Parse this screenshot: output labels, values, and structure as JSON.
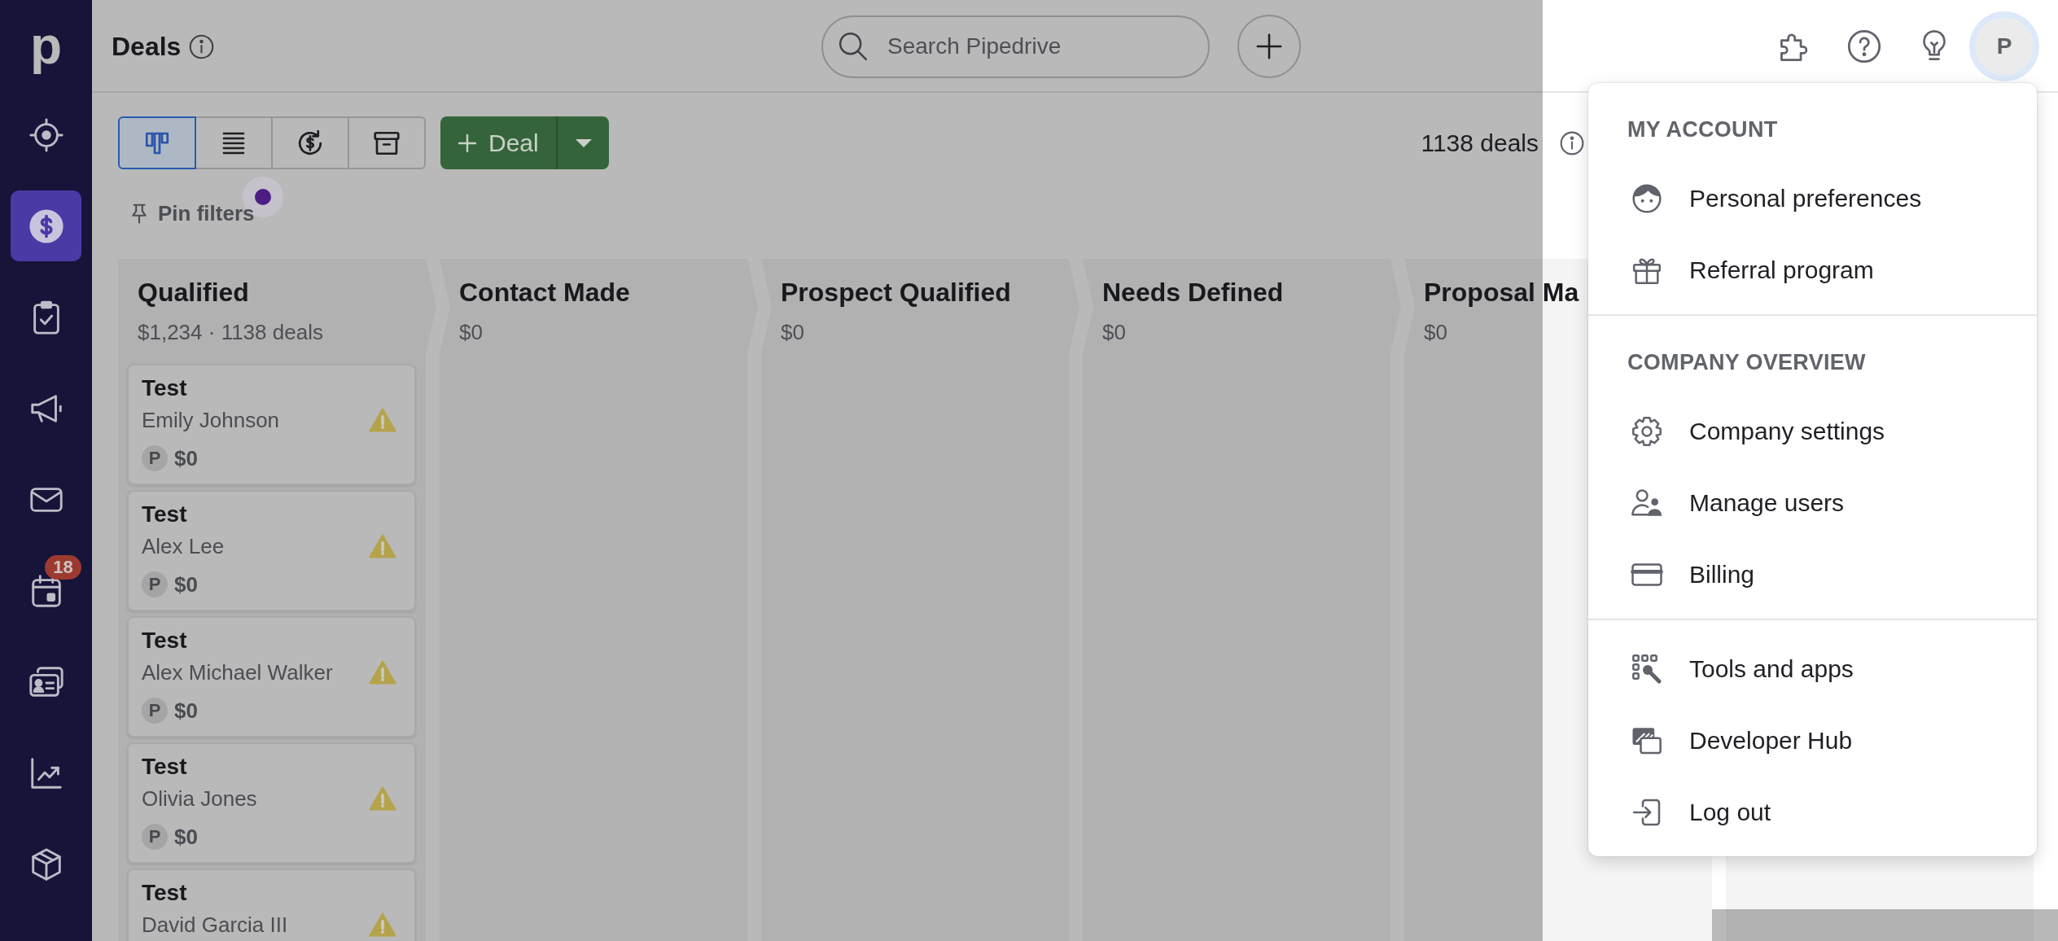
{
  "sidebar": {
    "logo": "p",
    "items": [
      {
        "kind": "leads",
        "selected": false
      },
      {
        "kind": "deals",
        "selected": true
      },
      {
        "kind": "activities",
        "selected": false
      },
      {
        "kind": "campaigns",
        "selected": false
      },
      {
        "kind": "mail",
        "selected": false
      },
      {
        "kind": "calendar",
        "selected": false,
        "badge": "18"
      },
      {
        "kind": "contacts",
        "selected": false
      },
      {
        "kind": "insights",
        "selected": false
      },
      {
        "kind": "products",
        "selected": false
      }
    ]
  },
  "header": {
    "title": "Deals",
    "search": {
      "placeholder": "Search Pipedrive"
    },
    "avatar": {
      "label": "P",
      "active": true
    }
  },
  "toolbar": {
    "views": [
      {
        "kind": "pipeline",
        "selected": true
      },
      {
        "kind": "list",
        "selected": false
      },
      {
        "kind": "forecast",
        "selected": false
      },
      {
        "kind": "archive",
        "selected": false
      }
    ],
    "add_button": "Deal",
    "deal_count": "1138 deals"
  },
  "filters": {
    "label": "Pin filters",
    "notification": true
  },
  "stages": [
    {
      "title": "Qualified",
      "summary": "$1,234 · 1138 deals",
      "deals": [
        {
          "title": "Test",
          "person": "Emily Johnson",
          "owner": "P",
          "value": "$0",
          "warning": true
        },
        {
          "title": "Test",
          "person": "Alex Lee",
          "owner": "P",
          "value": "$0",
          "warning": true
        },
        {
          "title": "Test",
          "person": "Alex Michael Walker",
          "owner": "P",
          "value": "$0",
          "warning": true
        },
        {
          "title": "Test",
          "person": "Olivia Jones",
          "owner": "P",
          "value": "$0",
          "warning": true
        },
        {
          "title": "Test",
          "person": "David Garcia III",
          "warning": true
        }
      ]
    },
    {
      "title": "Contact Made",
      "summary": "$0"
    },
    {
      "title": "Prospect Qualified",
      "summary": "$0"
    },
    {
      "title": "Needs Defined",
      "summary": "$0"
    },
    {
      "title": "Proposal Ma",
      "summary": "$0"
    }
  ],
  "account_menu": {
    "sections": [
      {
        "heading": "MY ACCOUNT",
        "items": [
          {
            "kind": "preferences",
            "label": "Personal preferences"
          },
          {
            "kind": "referral",
            "label": "Referral program"
          }
        ]
      },
      {
        "heading": "COMPANY OVERVIEW",
        "items": [
          {
            "kind": "company_settings",
            "label": "Company settings"
          },
          {
            "kind": "users",
            "label": "Manage users"
          },
          {
            "kind": "billing",
            "label": "Billing"
          }
        ]
      },
      {
        "items": [
          {
            "kind": "tools",
            "label": "Tools and apps"
          },
          {
            "kind": "developer",
            "label": "Developer Hub"
          },
          {
            "kind": "logout",
            "label": "Log out"
          }
        ]
      }
    ]
  }
}
